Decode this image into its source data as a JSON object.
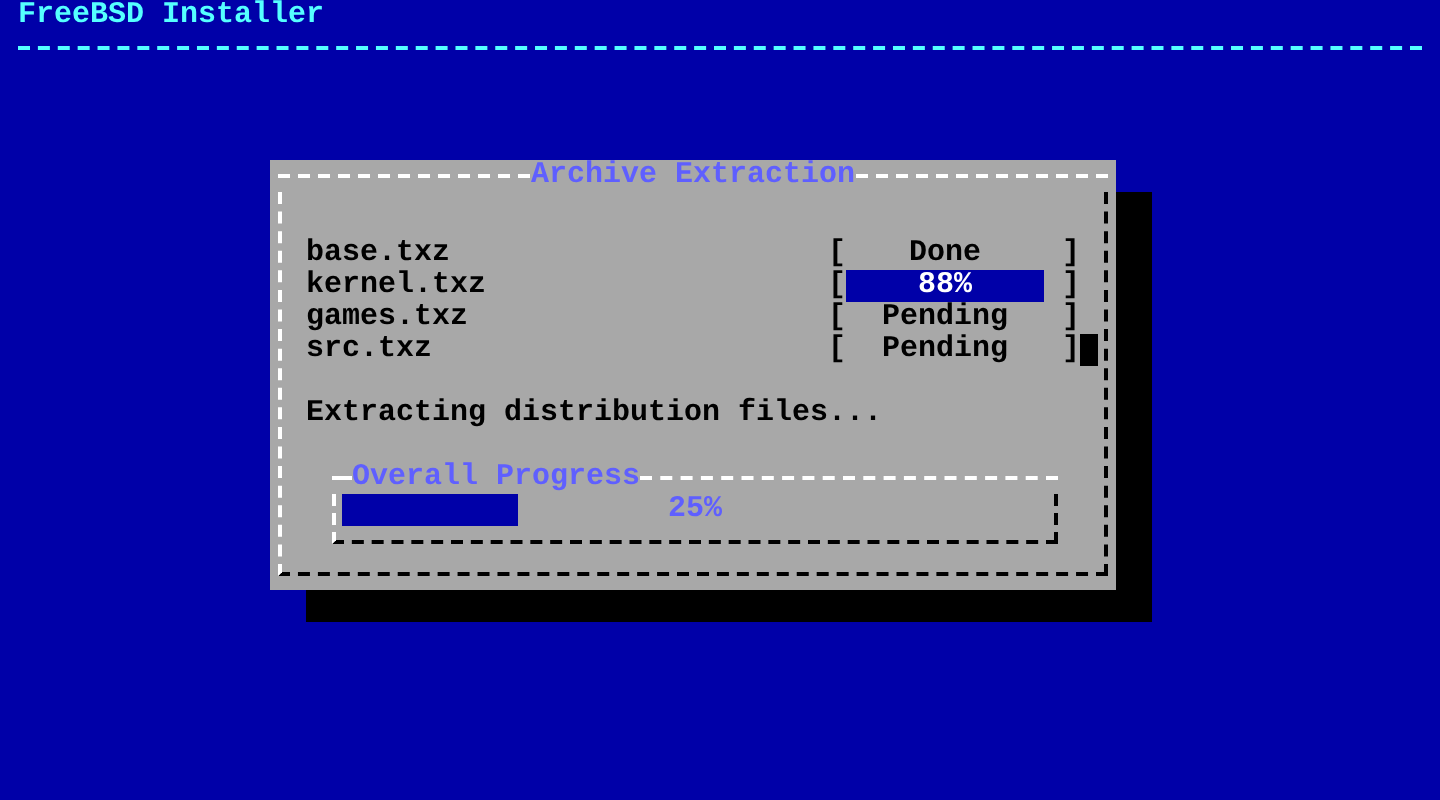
{
  "header": {
    "title": "FreeBSD Installer"
  },
  "dialog": {
    "title": "Archive Extraction",
    "items": [
      {
        "name": "base.txz",
        "kind": "text",
        "left_bracket": "[",
        "status": "Done",
        "right_bracket": "]",
        "cursor": false
      },
      {
        "name": "kernel.txz",
        "kind": "bar",
        "left_bracket": "[",
        "status": "88%",
        "right_bracket": "]",
        "cursor": false
      },
      {
        "name": "games.txz",
        "kind": "text",
        "left_bracket": "[",
        "status": "Pending",
        "right_bracket": "]",
        "cursor": false
      },
      {
        "name": "src.txz",
        "kind": "text",
        "left_bracket": "[",
        "status": "Pending",
        "right_bracket": "]",
        "cursor": true
      }
    ],
    "message": "Extracting distribution files...",
    "overall": {
      "title": "Overall Progress",
      "level": 0.25,
      "reading": "25%"
    }
  }
}
